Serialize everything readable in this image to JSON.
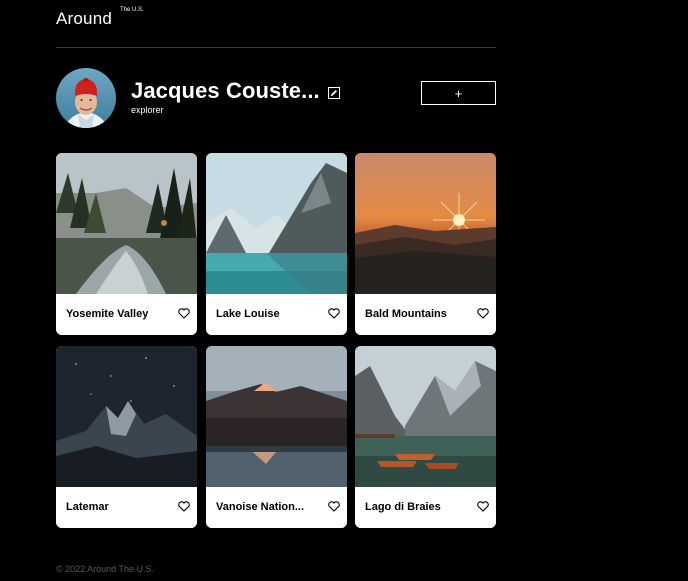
{
  "header": {
    "logo": "Around",
    "logo_sup": "The U.S."
  },
  "profile": {
    "name": "Jacques Couste...",
    "role": "explorer",
    "add_label": "+",
    "icons": {
      "avatar": "avatar",
      "edit": "edit-icon"
    }
  },
  "cards": [
    {
      "title": "Yosemite Valley"
    },
    {
      "title": "Lake Louise"
    },
    {
      "title": "Bald Mountains"
    },
    {
      "title": "Latemar"
    },
    {
      "title": "Vanoise Nation..."
    },
    {
      "title": "Lago di Braies"
    }
  ],
  "footer": {
    "copyright": "© 2022 Around The U.S."
  },
  "colors": {
    "background": "#000000",
    "card": "#ffffff",
    "text": "#ffffff",
    "card_text": "#000000",
    "footer_text": "#5a5a5a",
    "divider": "#3a3a3a"
  }
}
